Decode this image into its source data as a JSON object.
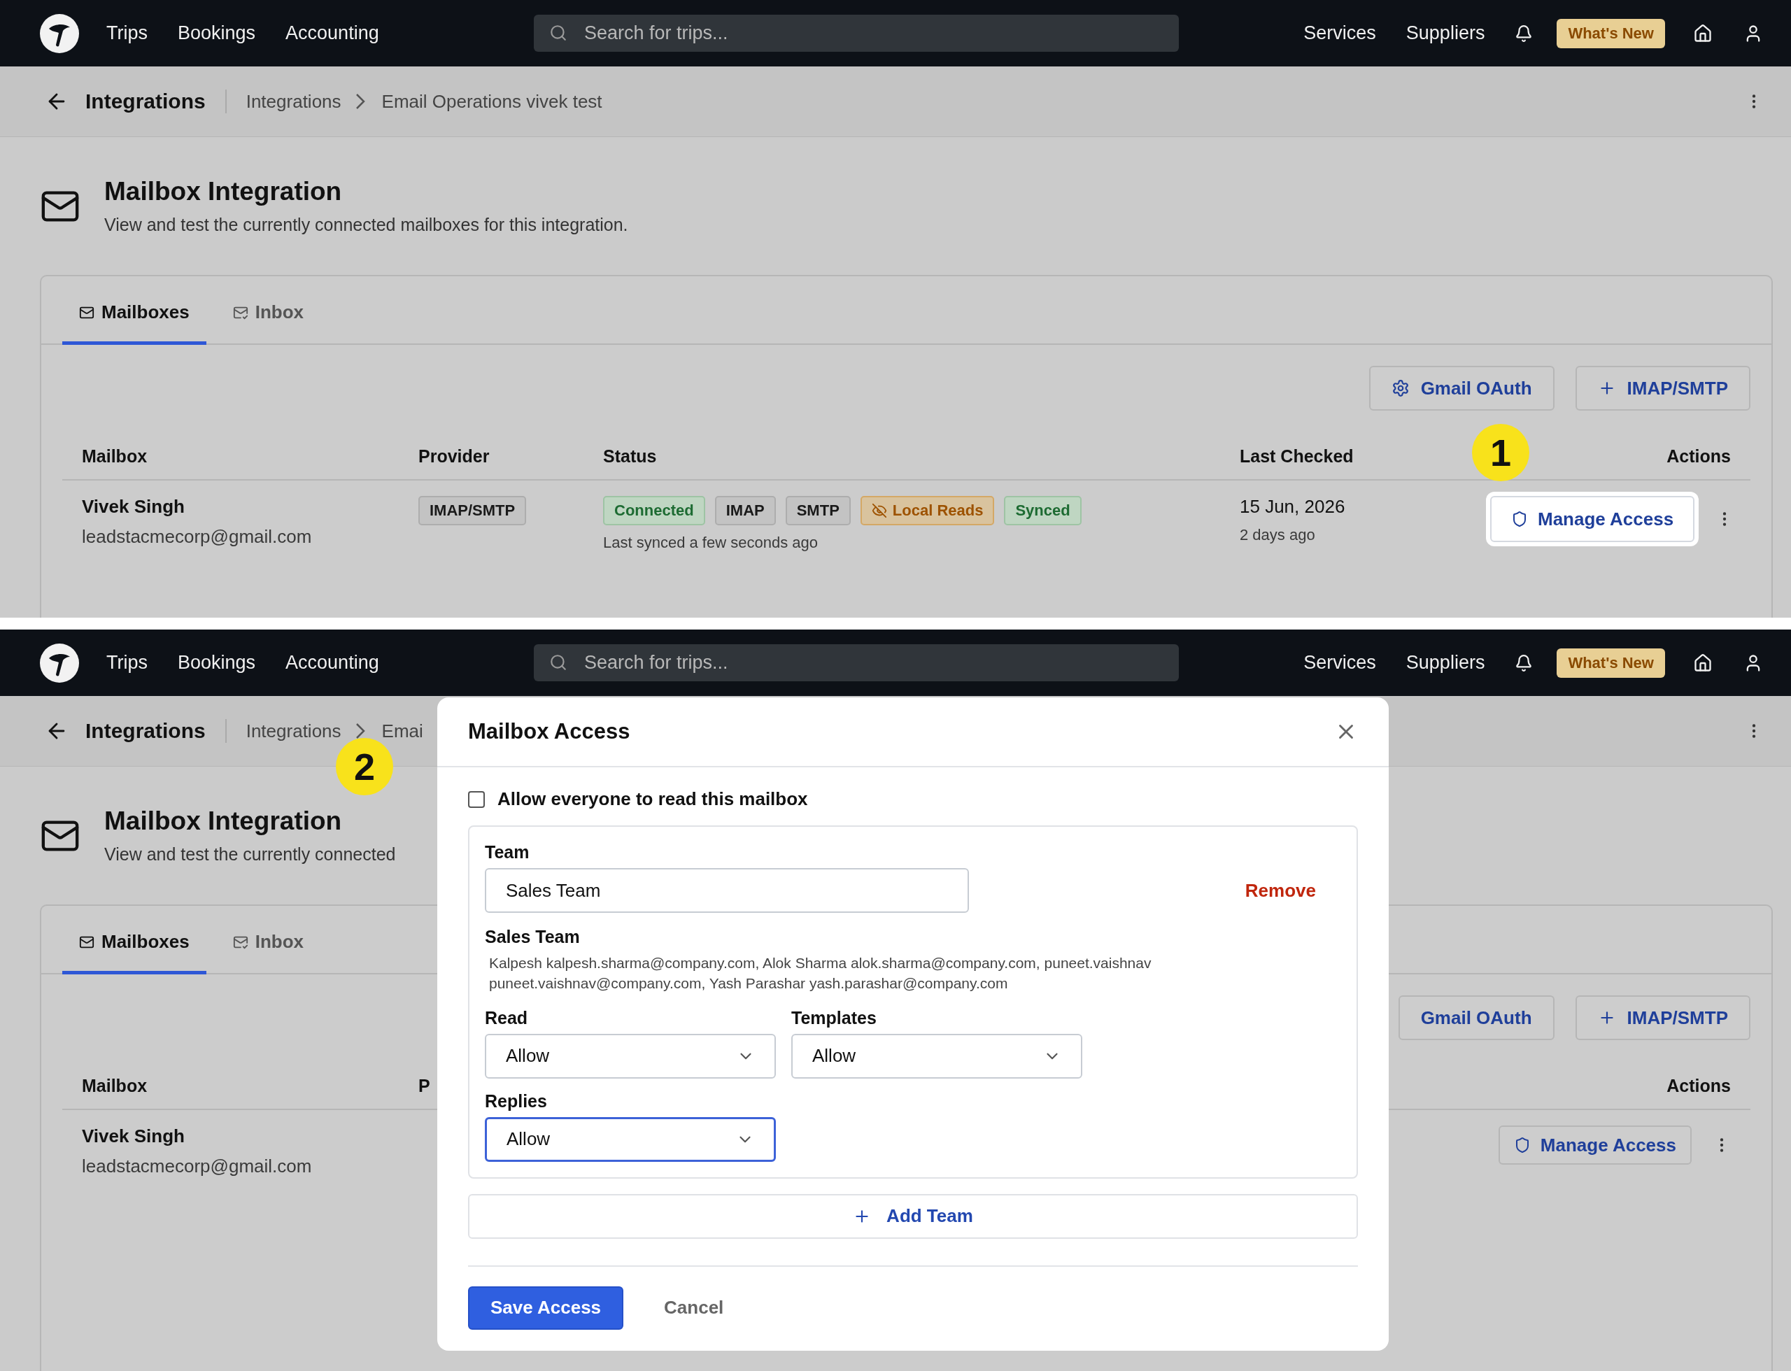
{
  "screens": [
    {
      "nav": {
        "items": [
          "Trips",
          "Bookings",
          "Accounting"
        ],
        "search": {
          "placeholder": "Search for trips..."
        },
        "right_items": [
          "Services",
          "Suppliers"
        ],
        "whats_new": "What's New"
      },
      "breadcrumb": {
        "title": "Integrations",
        "trail": [
          "Integrations",
          "Email Operations vivek test"
        ]
      },
      "header": {
        "title": "Mailbox Integration",
        "subtitle": "View and test the currently connected mailboxes for this integration."
      },
      "tabs": [
        {
          "label": "Mailboxes",
          "selected": true
        },
        {
          "label": "Inbox",
          "selected": false
        }
      ],
      "buttons": [
        {
          "label": "Gmail OAuth",
          "kind": "settings"
        },
        {
          "label": "IMAP/SMTP",
          "kind": "add"
        }
      ],
      "table": {
        "columns": [
          {
            "label": "Mailbox",
            "kind": "mailbox"
          },
          {
            "label": "Provider",
            "kind": "provider"
          },
          {
            "label": "Status",
            "kind": "status"
          },
          {
            "label": "Last Checked",
            "kind": "checked"
          },
          {
            "label": "Actions",
            "kind": "actions"
          }
        ],
        "rows": [
          {
            "name": "Vivek Singh",
            "email": "leadstacmecorp@gmail.com",
            "provider": "IMAP/SMTP",
            "badges": [
              {
                "label": "Connected",
                "kind": "success"
              },
              {
                "label": "IMAP",
                "kind": "neutral"
              },
              {
                "label": "SMTP",
                "kind": "neutral"
              },
              {
                "label": "Local Reads",
                "kind": "warning"
              },
              {
                "label": "Synced",
                "kind": "success"
              }
            ],
            "sync_note": "Last synced a few seconds ago",
            "date": "15 Jun, 2026",
            "ago": "2 days ago",
            "action": "Manage Access",
            "highlighted": true
          }
        ]
      },
      "callout": {
        "label": "1"
      }
    },
    {
      "nav": {
        "items": [
          "Trips",
          "Bookings",
          "Accounting"
        ],
        "search": {
          "placeholder": "Search for trips..."
        },
        "right_items": [
          "Services",
          "Suppliers"
        ],
        "whats_new": "What's New"
      },
      "breadcrumb": {
        "title": "Integrations",
        "trail": [
          "Integrations",
          "Emai"
        ]
      },
      "header": {
        "title": "Mailbox Integration",
        "subtitle": "View and test the currently connected"
      },
      "tabs": [
        {
          "label": "Mailboxes",
          "selected": true
        },
        {
          "label": "Inbox",
          "selected": false
        }
      ],
      "buttons": [
        {
          "label": "Gmail OAuth",
          "kind": "text"
        },
        {
          "label": "IMAP/SMTP",
          "kind": "add"
        }
      ],
      "table": {
        "columns": [
          {
            "label": "Mailbox",
            "kind": "mailbox"
          },
          {
            "label": "P",
            "kind": "provider"
          },
          {
            "label": "Actions",
            "kind": "actions"
          }
        ],
        "rows": [
          {
            "name": "Vivek Singh",
            "email": "leadstacmecorp@gmail.com",
            "action": "Manage Access",
            "highlighted": false
          }
        ]
      },
      "callout": {
        "label": "2"
      },
      "modal": {
        "title": "Mailbox Access",
        "allow_everyone": {
          "label": "Allow everyone to read this mailbox",
          "checked": false
        },
        "teams": [
          {
            "label": "Team",
            "value": "Sales Team",
            "remove": "Remove",
            "members_title": "Sales Team",
            "members": "Kalpesh kalpesh.sharma@company.com, Alok Sharma alok.sharma@company.com, puneet.vaishnav puneet.vaishnav@company.com, Yash Parashar yash.parashar@company.com",
            "permissions": [
              {
                "label": "Read",
                "value": "Allow",
                "focused": false
              },
              {
                "label": "Templates",
                "value": "Allow",
                "focused": false
              },
              {
                "label": "Replies",
                "value": "Allow",
                "focused": true
              }
            ]
          }
        ],
        "add": "Add Team",
        "save": "Save Access",
        "cancel": "Cancel"
      }
    }
  ]
}
